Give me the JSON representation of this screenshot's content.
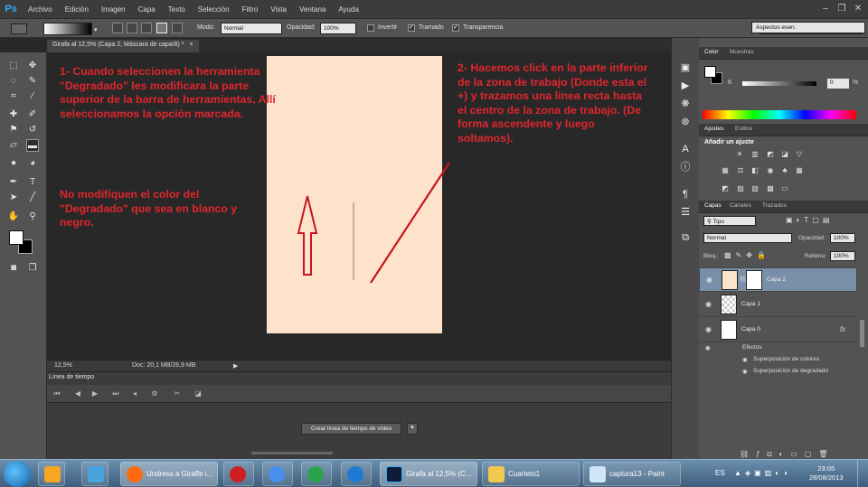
{
  "app": {
    "logo": "Ps"
  },
  "menu": [
    "Archivo",
    "Edición",
    "Imagen",
    "Capa",
    "Texto",
    "Selección",
    "Filtro",
    "Vista",
    "Ventana",
    "Ayuda"
  ],
  "window_controls": {
    "minimize": "–",
    "restore": "❐",
    "close": "✕"
  },
  "options_bar": {
    "mode_label": "Modo:",
    "mode_value": "Normal",
    "opacity_label": "Opacidad:",
    "opacity_value": "100%",
    "invert_label": "Invertir",
    "dither_label": "Tramado",
    "transparency_label": "Transparencia",
    "workspace_value": "Aspectos esen."
  },
  "document": {
    "tab_title": "Girafa al 12,5% (Capa 2, Máscara de capa/8) *",
    "tab_close": "×",
    "zoom": "12,5%",
    "doc_size": "Doc: 20,1 MB/26,9 MB",
    "canvas_color": "#fde3cc"
  },
  "timeline": {
    "tab_label": "Línea de tiempo",
    "create_button": "Crear línea de tiempo de vídeo"
  },
  "color_panel": {
    "tabs": [
      "Color",
      "Muestras"
    ],
    "channel": "K",
    "value": "0",
    "unit": "%"
  },
  "adjustments_panel": {
    "tabs": [
      "Ajustes",
      "Estilos"
    ],
    "heading": "Añadir un ajuste"
  },
  "layers_panel": {
    "tabs": [
      "Capas",
      "Canales",
      "Trazados"
    ],
    "filter": "Tipo",
    "blend_mode": "Normal",
    "opacity_label": "Opacidad:",
    "opacity_value": "100%",
    "lock_label": "Bloq.:",
    "fill_label": "Relleno:",
    "fill_value": "100%",
    "layers": [
      {
        "name": "Capa 2",
        "selected": true
      },
      {
        "name": "Capa 1",
        "selected": false
      },
      {
        "name": "Capa 0",
        "selected": false
      }
    ],
    "effects_label": "Efectos",
    "effects": [
      "Superposición de colores",
      "Superposición de degradado"
    ],
    "fx": "fx"
  },
  "annotations": {
    "note1": "1- Cuando seleccionen la herramienta \"Degradado\" les modificara la parte superior de la barra de herramientas, Allí seleccionamos la opción marcada.",
    "note2": "No modifiquen el color del \"Degradado\" que sea en blanco y negro.",
    "note3": "2- Hacemos click en la parte inferior de la zona de trabajo (Donde esta el +) y trazamos una linea recta hasta el centro de la zona de trabajo. (De forma ascendente y luego soltamos).",
    "color": "#e0262e"
  },
  "taskbar": {
    "items": [
      {
        "label": "",
        "color": "#4aa3df"
      },
      {
        "label": "",
        "color": "#f5a623"
      },
      {
        "label": "",
        "color": "#e8e8e8"
      },
      {
        "label": "Undress a Giraffe i...",
        "color": "#ff6a13"
      },
      {
        "label": "",
        "color": "#cc2020"
      },
      {
        "label": "",
        "color": "#4a8ff0"
      },
      {
        "label": "",
        "color": "#2ba24c"
      },
      {
        "label": "",
        "color": "#1e7bd1"
      },
      {
        "label": "Girafa al 12,5% (C...",
        "color": "#0e1c3a"
      },
      {
        "label": "Cuarteto1",
        "color": "#f2c94c"
      },
      {
        "label": "captura13 - Paint",
        "color": "#d0e6f7"
      }
    ],
    "language": "ES",
    "time": "23:05",
    "date": "28/08/2013"
  }
}
